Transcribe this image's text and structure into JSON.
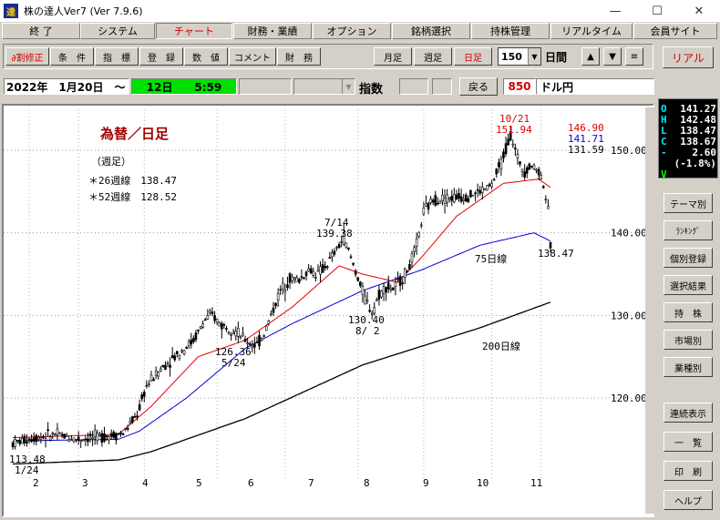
{
  "window": {
    "icon_label": "達",
    "title": "株の達人Ver7 (Ver 7.9.6)",
    "minimize": "—",
    "maximize": "☐",
    "close": "✕"
  },
  "menu": [
    {
      "label": "終 了"
    },
    {
      "label": "システム"
    },
    {
      "label": "チャート"
    },
    {
      "label": "財務・業績"
    },
    {
      "label": "オプション"
    },
    {
      "label": "銘柄選択"
    },
    {
      "label": "持株管理"
    },
    {
      "label": "リアルタイム"
    },
    {
      "label": "会員サイト"
    }
  ],
  "toolbar": {
    "buttons": [
      "∂割修正",
      "条　件",
      "指　標",
      "登　録",
      "数　値",
      "コメント",
      "財　務"
    ],
    "monthly": "月足",
    "weekly": "週足",
    "daily": "日足",
    "days_value": "150",
    "days_unit": "日間",
    "up": "▲",
    "down": "▼",
    "menu": "≡",
    "real": "リアル"
  },
  "info": {
    "date": "2022年　1月20日　～",
    "period": "12日　　5:59",
    "index_label": "指数",
    "back_button": "戻る",
    "code": "850",
    "name": "ドル円"
  },
  "quote": {
    "o": "141.27",
    "h": "142.48",
    "l": "138.47",
    "c": "138.67",
    "change": "2.60",
    "change_pct": "(-1.8%)",
    "keys": {
      "o": "O",
      "h": "H",
      "l": "L",
      "c": "C",
      "dash": "-",
      "v": "V"
    }
  },
  "side_buttons": [
    "テーマ別",
    "ﾗﾝｷﾝｸﾞ",
    "個別登録",
    "選択結果",
    "持　株",
    "市場別",
    "業種別",
    "連続表示",
    "一　覧",
    "印　刷",
    "ヘルプ"
  ],
  "chart": {
    "title": "為替／日足",
    "subtitle": "（週足）",
    "ma26": "＊26週線　138.47",
    "ma52": "＊52週線　128.52",
    "legend_values": {
      "red": "146.90",
      "blue": "141.71",
      "black": "131.59"
    },
    "label_75": "75日線",
    "label_200": "200日線",
    "annotations": {
      "high_date": "10/21",
      "high_value": "151.94",
      "jul_date": "7/14",
      "jul_value": "139.38",
      "aug_value": "130.40",
      "aug_date": "8/ 2",
      "may_value": "126.36",
      "may_date": "5/24",
      "jan_value": "113.48",
      "jan_date": "1/24",
      "last_value": "138.47"
    }
  },
  "chart_data": {
    "type": "candlestick",
    "title": "為替／日足",
    "x_tick_labels": [
      "2",
      "3",
      "4",
      "5",
      "6",
      "7",
      "8",
      "9",
      "10",
      "11"
    ],
    "y_tick_labels": [
      "120.00",
      "130.00",
      "140.00",
      "150.00"
    ],
    "ylim": [
      112,
      152.5
    ],
    "price_path": [
      [
        1,
        114.5
      ],
      [
        10,
        115.2
      ],
      [
        20,
        115.6
      ],
      [
        28,
        115.0
      ],
      [
        38,
        115.3
      ],
      [
        48,
        115.7
      ],
      [
        54,
        118.0
      ],
      [
        58,
        121.5
      ],
      [
        64,
        123.5
      ],
      [
        70,
        125.0
      ],
      [
        78,
        127.0
      ],
      [
        83,
        129.5
      ],
      [
        86,
        130.0
      ],
      [
        90,
        128.8
      ],
      [
        94,
        128.5
      ],
      [
        97,
        127.8
      ],
      [
        100,
        127.0
      ],
      [
        103,
        126.5
      ],
      [
        105,
        126.4
      ],
      [
        108,
        127.8
      ],
      [
        111,
        130.0
      ],
      [
        115,
        133.0
      ],
      [
        119,
        134.5
      ],
      [
        123,
        134.3
      ],
      [
        127,
        135.5
      ],
      [
        131,
        135.0
      ],
      [
        135,
        136.2
      ],
      [
        139,
        138.0
      ],
      [
        142,
        139.4
      ],
      [
        145,
        137.0
      ],
      [
        148,
        134.5
      ],
      [
        151,
        132.0
      ],
      [
        154,
        130.4
      ],
      [
        157,
        132.5
      ],
      [
        160,
        133.5
      ],
      [
        163,
        133.2
      ],
      [
        167,
        134.5
      ],
      [
        170,
        136.0
      ],
      [
        173,
        138.5
      ],
      [
        176,
        142.5
      ],
      [
        180,
        144.0
      ],
      [
        185,
        144.2
      ],
      [
        190,
        144.3
      ],
      [
        195,
        144.5
      ],
      [
        200,
        145.0
      ],
      [
        205,
        145.8
      ],
      [
        209,
        148.5
      ],
      [
        213,
        151.9
      ],
      [
        216,
        149.0
      ],
      [
        219,
        147.5
      ],
      [
        222,
        148.2
      ],
      [
        225,
        147.5
      ],
      [
        227,
        146.0
      ],
      [
        229,
        142.5
      ],
      [
        230,
        138.5
      ]
    ],
    "ma75": [
      [
        1,
        114.8
      ],
      [
        46,
        115.0
      ],
      [
        55,
        116.0
      ],
      [
        75,
        120.0
      ],
      [
        100,
        126.0
      ],
      [
        120,
        129.0
      ],
      [
        150,
        133.0
      ],
      [
        175,
        135.5
      ],
      [
        200,
        138.5
      ],
      [
        223,
        140.0
      ],
      [
        230,
        139.0
      ]
    ],
    "ma200": [
      [
        1,
        112.0
      ],
      [
        46,
        112.5
      ],
      [
        60,
        113.5
      ],
      [
        100,
        117.5
      ],
      [
        150,
        124.0
      ],
      [
        200,
        128.5
      ],
      [
        230,
        131.6
      ]
    ],
    "ma_red": [
      [
        1,
        115.2
      ],
      [
        46,
        115.6
      ],
      [
        60,
        119.0
      ],
      [
        80,
        125.0
      ],
      [
        100,
        127.0
      ],
      [
        120,
        131.0
      ],
      [
        140,
        136.0
      ],
      [
        150,
        135.0
      ],
      [
        165,
        134.0
      ],
      [
        175,
        137.0
      ],
      [
        190,
        142.0
      ],
      [
        210,
        146.0
      ],
      [
        225,
        146.5
      ],
      [
        230,
        145.5
      ]
    ]
  }
}
